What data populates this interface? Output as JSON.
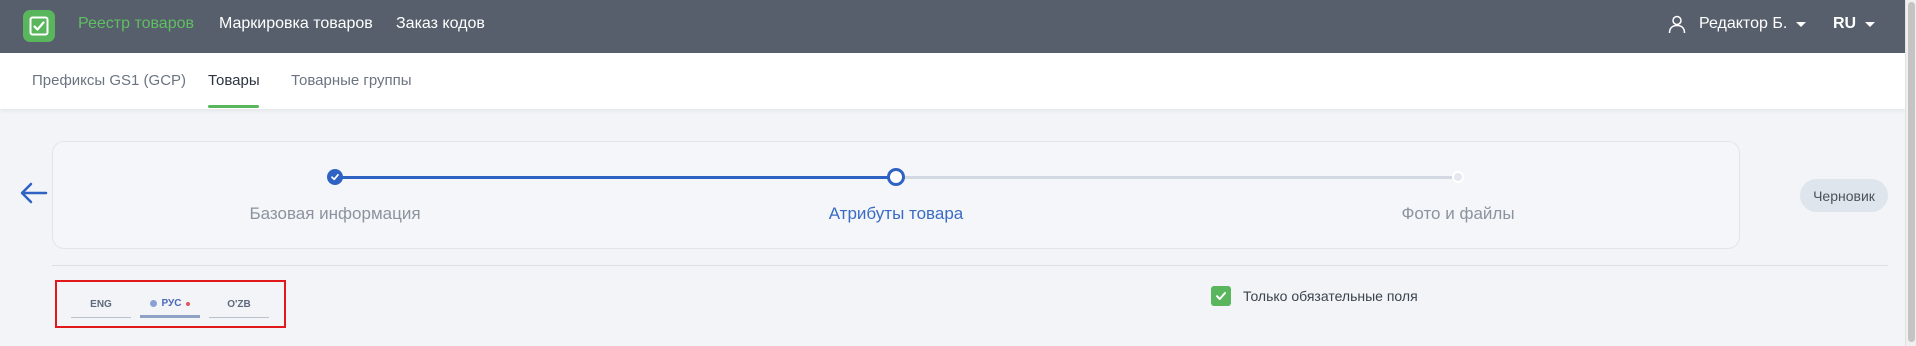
{
  "header": {
    "nav": [
      {
        "label": "Реестр товаров",
        "active": true
      },
      {
        "label": "Маркировка товаров",
        "active": false
      },
      {
        "label": "Заказ кодов",
        "active": false
      }
    ],
    "user": {
      "name": "Редактор Б.",
      "icon": "user-icon"
    },
    "language": "RU",
    "logo_icon": "checklist-icon",
    "accent_color": "#5ab65c",
    "bar_color": "#565f6b"
  },
  "subtabs": [
    {
      "label": "Префиксы GS1 (GCP)",
      "active": false
    },
    {
      "label": "Товары",
      "active": true
    },
    {
      "label": "Товарные группы",
      "active": false
    }
  ],
  "stepper": {
    "steps": [
      {
        "label": "Базовая информация",
        "status": "completed"
      },
      {
        "label": "Атрибуты товара",
        "status": "current"
      },
      {
        "label": "Фото и файлы",
        "status": "pending"
      }
    ],
    "active_color": "#2f63c3",
    "pending_color": "#d3d9e2"
  },
  "status_badge": "Черновик",
  "language_tabs": [
    {
      "label": "ENG",
      "active": false,
      "required": false
    },
    {
      "label": "РУС",
      "active": true,
      "required": true
    },
    {
      "label": "O'ZB",
      "active": false,
      "required": false
    }
  ],
  "required_only": {
    "label": "Только обязательные поля",
    "checked": true
  }
}
